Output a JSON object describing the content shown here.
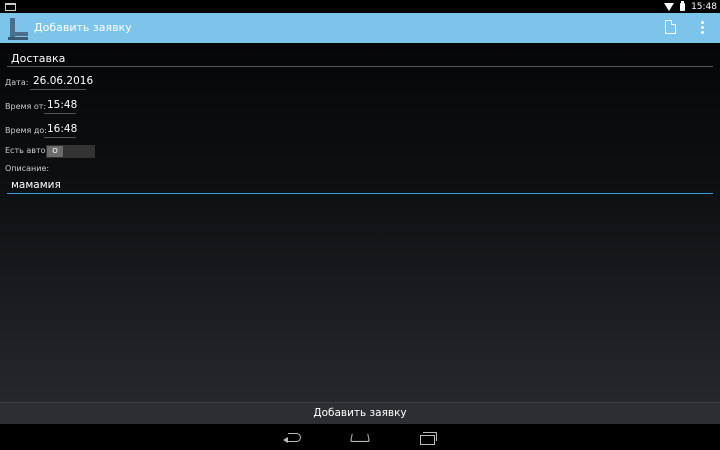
{
  "status_bar": {
    "time": "15:48"
  },
  "action_bar": {
    "title": "Добавить заявку",
    "accent_color": "#7cc4ea"
  },
  "form": {
    "title_value": "Доставка",
    "date_label": "Дата:",
    "date_value": "26.06.2016",
    "time_from_label": "Время от:",
    "time_from_value": "15:48",
    "time_to_label": "Время до:",
    "time_to_value": "16:48",
    "has_car_label": "Есть авто?",
    "has_car_toggle": "O",
    "description_label": "Описание:",
    "description_value": "мамамия"
  },
  "bottom": {
    "submit_label": "Добавить заявку"
  }
}
